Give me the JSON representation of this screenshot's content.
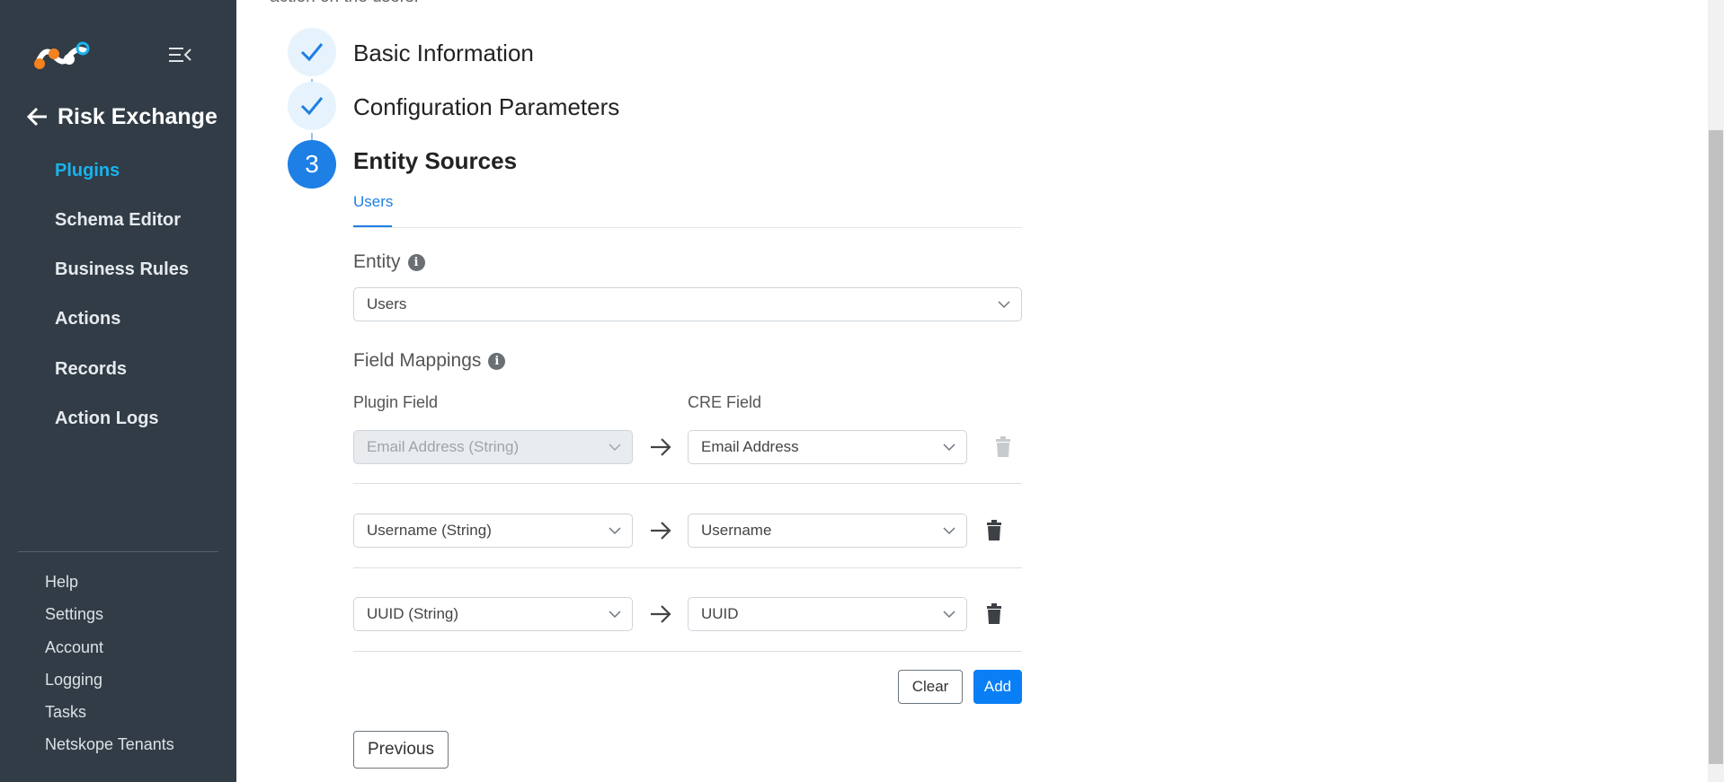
{
  "sidebar": {
    "back_title": "Risk Exchange",
    "nav": [
      "Plugins",
      "Schema Editor",
      "Business Rules",
      "Actions",
      "Records",
      "Action Logs"
    ],
    "active_nav": "Plugins",
    "footer": [
      "Help",
      "Settings",
      "Account",
      "Logging",
      "Tasks",
      "Netskope Tenants"
    ]
  },
  "main": {
    "top_text": "action on the users.",
    "steps": [
      {
        "status": "done",
        "label": "Basic Information"
      },
      {
        "status": "done",
        "label": "Configuration Parameters"
      },
      {
        "status": "current",
        "number": "3",
        "label": "Entity Sources"
      }
    ],
    "tab": "Users",
    "entity": {
      "label": "Entity",
      "value": "Users"
    },
    "field_mappings": {
      "label": "Field Mappings",
      "plugin_field_header": "Plugin Field",
      "cre_field_header": "CRE Field",
      "rows": [
        {
          "plugin_field": "Email Address (String)",
          "cre_field": "Email Address",
          "disabled": true
        },
        {
          "plugin_field": "Username (String)",
          "cre_field": "Username",
          "disabled": false
        },
        {
          "plugin_field": "UUID (String)",
          "cre_field": "UUID",
          "disabled": false
        }
      ]
    },
    "buttons": {
      "clear": "Clear",
      "add": "Add",
      "previous": "Previous"
    }
  },
  "colors": {
    "sidebar_bg": "#313c46",
    "active_nav": "#19b3ec",
    "primary": "#0a7ff5"
  }
}
